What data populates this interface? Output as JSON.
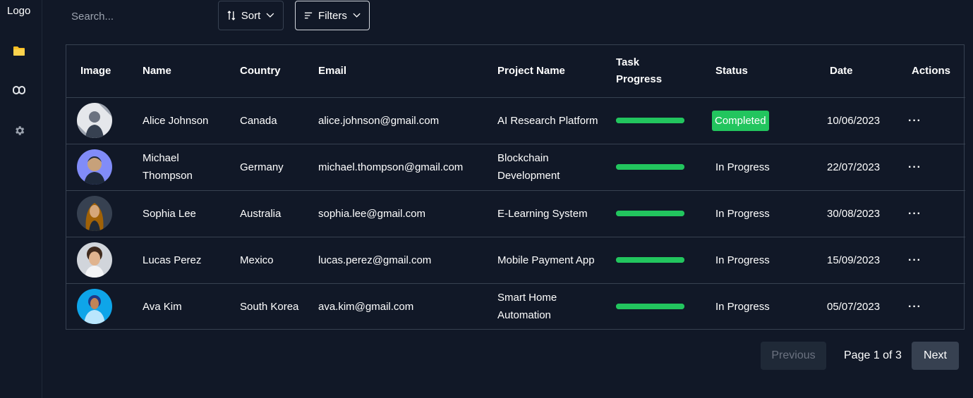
{
  "sidebar": {
    "logo": "Logo",
    "items": [
      {
        "icon": "folder-icon"
      },
      {
        "icon": "people-icon"
      },
      {
        "icon": "gear-icon"
      }
    ]
  },
  "toolbar": {
    "search_placeholder": "Search...",
    "sort_label": "Sort",
    "filters_label": "Filters"
  },
  "table": {
    "headers": [
      "Image",
      "Name",
      "Country",
      "Email",
      "Project Name",
      "Task Progress",
      "Status",
      "Date",
      "Actions"
    ],
    "rows": [
      {
        "name": "Alice Johnson",
        "country": "Canada",
        "email": "alice.johnson@gmail.com",
        "project": "AI Research Platform",
        "progress": 1.0,
        "status": "Completed",
        "date": "10/06/2023",
        "actions": "···"
      },
      {
        "name": "Michael Thompson",
        "country": "Germany",
        "email": "michael.thompson@gmail.com",
        "project": "Blockchain Development",
        "progress": 1.0,
        "status": "In Progress",
        "date": "22/07/2023",
        "actions": "···"
      },
      {
        "name": "Sophia Lee",
        "country": "Australia",
        "email": "sophia.lee@gmail.com",
        "project": "E-Learning System",
        "progress": 1.0,
        "status": "In Progress",
        "date": "30/08/2023",
        "actions": "···"
      },
      {
        "name": "Lucas Perez",
        "country": "Mexico",
        "email": "lucas.perez@gmail.com",
        "project": "Mobile Payment App",
        "progress": 1.0,
        "status": "In Progress",
        "date": "15/09/2023",
        "actions": "···"
      },
      {
        "name": "Ava Kim",
        "country": "South Korea",
        "email": "ava.kim@gmail.com",
        "project": "Smart Home Automation",
        "progress": 1.0,
        "status": "In Progress",
        "date": "05/07/2023",
        "actions": "···"
      }
    ]
  },
  "pagination": {
    "previous_label": "Previous",
    "page_info": "Page 1 of 3",
    "next_label": "Next"
  },
  "colors": {
    "background": "#111827",
    "progress": "#22c55e",
    "completed_badge": "#22c55e",
    "folder_icon": "#fbbf24"
  }
}
